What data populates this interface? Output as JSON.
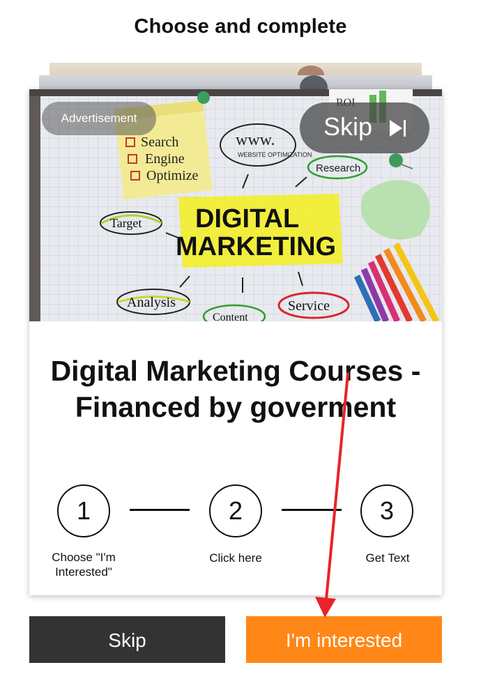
{
  "header": {
    "title": "Choose and complete"
  },
  "ad": {
    "advertisement_label": "Advertisement",
    "skip_label": "Skip",
    "hero_image": {
      "sticky_note": [
        "Search",
        "Engine",
        "Optimize"
      ],
      "bubble_www": "www.",
      "bubble_www_sub": "WEBSITE OPTIMIZATION",
      "roi": "ROI",
      "research": "Research",
      "headline_1": "DIGITAL",
      "headline_2": "MARKETING",
      "target": "Target",
      "analysis": "Analysis",
      "content": "Content",
      "service": "Service"
    },
    "title": "Digital Marketing Courses - Financed by goverment"
  },
  "steps": [
    {
      "number": "1",
      "label": "Choose \"I'm Interested\""
    },
    {
      "number": "2",
      "label": "Click here"
    },
    {
      "number": "3",
      "label": "Get Text"
    }
  ],
  "buttons": {
    "skip": "Skip",
    "interested": "I'm interested"
  },
  "colors": {
    "interested": "#ff8717",
    "skip": "#333333",
    "annotation_arrow": "#e8232a"
  }
}
